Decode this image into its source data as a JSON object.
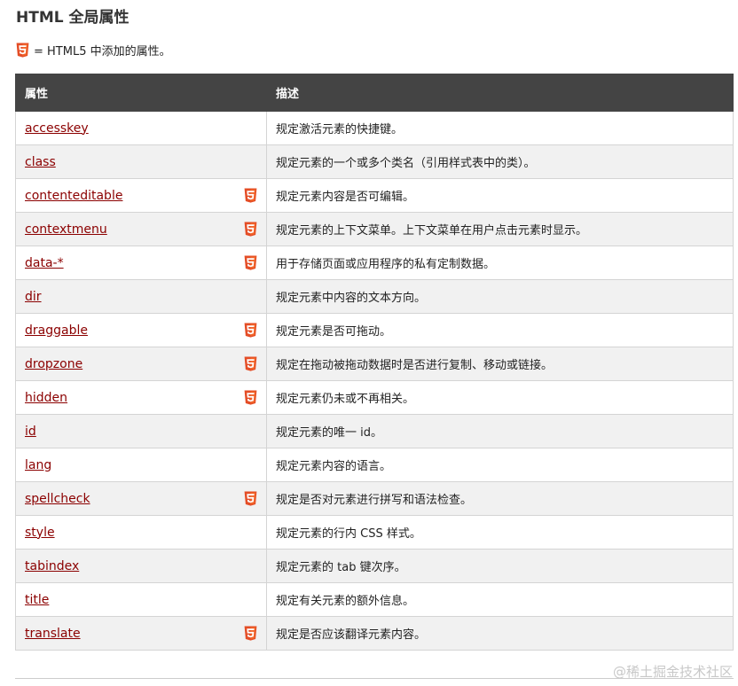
{
  "header": {
    "title": "HTML 全局属性",
    "legend_text": "= HTML5 中添加的属性。"
  },
  "table": {
    "columns": [
      "属性",
      "描述"
    ],
    "rows": [
      {
        "attribute": "accesskey",
        "html5": false,
        "description": "规定激活元素的快捷键。"
      },
      {
        "attribute": "class",
        "html5": false,
        "description": "规定元素的一个或多个类名（引用样式表中的类）。"
      },
      {
        "attribute": "contenteditable",
        "html5": true,
        "description": "规定元素内容是否可编辑。"
      },
      {
        "attribute": "contextmenu",
        "html5": true,
        "description": "规定元素的上下文菜单。上下文菜单在用户点击元素时显示。"
      },
      {
        "attribute": "data-*",
        "html5": true,
        "description": "用于存储页面或应用程序的私有定制数据。"
      },
      {
        "attribute": "dir",
        "html5": false,
        "description": "规定元素中内容的文本方向。"
      },
      {
        "attribute": "draggable",
        "html5": true,
        "description": "规定元素是否可拖动。"
      },
      {
        "attribute": "dropzone",
        "html5": true,
        "description": "规定在拖动被拖动数据时是否进行复制、移动或链接。"
      },
      {
        "attribute": "hidden",
        "html5": true,
        "description": "规定元素仍未或不再相关。"
      },
      {
        "attribute": "id",
        "html5": false,
        "description": "规定元素的唯一 id。"
      },
      {
        "attribute": "lang",
        "html5": false,
        "description": "规定元素内容的语言。"
      },
      {
        "attribute": "spellcheck",
        "html5": true,
        "description": "规定是否对元素进行拼写和语法检查。"
      },
      {
        "attribute": "style",
        "html5": false,
        "description": "规定元素的行内 CSS 样式。"
      },
      {
        "attribute": "tabindex",
        "html5": false,
        "description": "规定元素的 tab 键次序。"
      },
      {
        "attribute": "title",
        "html5": false,
        "description": "规定有关元素的额外信息。"
      },
      {
        "attribute": "translate",
        "html5": true,
        "description": "规定是否应该翻译元素内容。"
      }
    ]
  },
  "watermark": "@稀土掘金技术社区",
  "icons": {
    "html5_badge": "html5-icon"
  },
  "colors": {
    "header_bg": "#444444",
    "link": "#8b0000",
    "html5_orange": "#e44d26",
    "row_alt": "#f1f1f1"
  }
}
